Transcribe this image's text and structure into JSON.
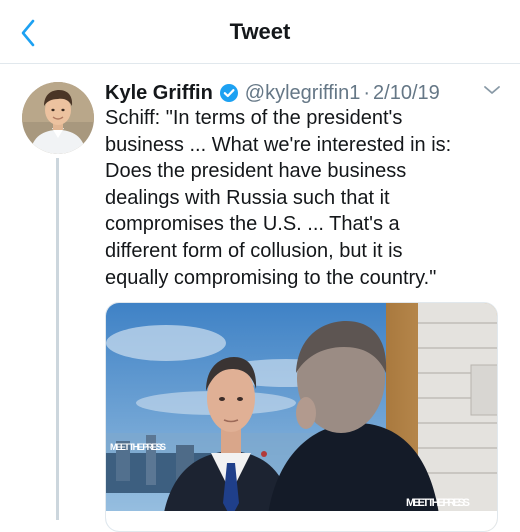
{
  "header": {
    "title": "Tweet",
    "back_icon": "chevron-left-icon",
    "accent": "#1da1f2"
  },
  "tweet": {
    "author_name": "Kyle Griffin",
    "verified_icon": "verified-badge-icon",
    "handle": "@kylegriffin1",
    "separator": "·",
    "date": "2/10/19",
    "menu_icon": "chevron-down-icon",
    "text": "Schiff: \"In terms of the president's\nbusiness ... What we're interested in is:\nDoes the president have business\ndealings with Russia such that it\ncompromises the U.S. ... That's a\ndifferent form of collusion, but it is\nequally compromising to the country.\""
  },
  "media": {
    "logo_left": "MEET THE PRESS",
    "logo_right": "MEET THE PRESS"
  }
}
